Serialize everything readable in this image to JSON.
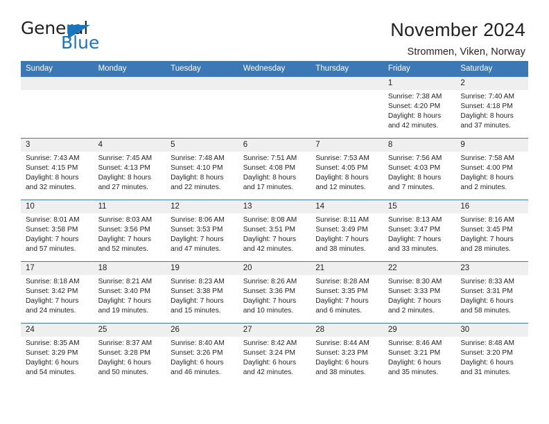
{
  "logo": {
    "word_top": "General",
    "word_bottom": "Blue",
    "triangle": "triangle-icon",
    "accent_color": "#1b75bc"
  },
  "header": {
    "title": "November 2024",
    "subtitle": "Strommen, Viken, Norway"
  },
  "theme": {
    "header_bar": "#3b78b5",
    "daynum_band": "#efefef",
    "text": "#231f20"
  },
  "weekdays": [
    "Sunday",
    "Monday",
    "Tuesday",
    "Wednesday",
    "Thursday",
    "Friday",
    "Saturday"
  ],
  "labels": {
    "sunrise": "Sunrise:",
    "sunset": "Sunset:",
    "daylight": "Daylight:"
  },
  "weeks": [
    [
      {
        "day": "",
        "blank": true
      },
      {
        "day": "",
        "blank": true
      },
      {
        "day": "",
        "blank": true
      },
      {
        "day": "",
        "blank": true
      },
      {
        "day": "",
        "blank": true
      },
      {
        "day": "1",
        "sunrise": "Sunrise: 7:38 AM",
        "sunset": "Sunset: 4:20 PM",
        "daylight1": "Daylight: 8 hours",
        "daylight2": "and 42 minutes."
      },
      {
        "day": "2",
        "sunrise": "Sunrise: 7:40 AM",
        "sunset": "Sunset: 4:18 PM",
        "daylight1": "Daylight: 8 hours",
        "daylight2": "and 37 minutes."
      }
    ],
    [
      {
        "day": "3",
        "sunrise": "Sunrise: 7:43 AM",
        "sunset": "Sunset: 4:15 PM",
        "daylight1": "Daylight: 8 hours",
        "daylight2": "and 32 minutes."
      },
      {
        "day": "4",
        "sunrise": "Sunrise: 7:45 AM",
        "sunset": "Sunset: 4:13 PM",
        "daylight1": "Daylight: 8 hours",
        "daylight2": "and 27 minutes."
      },
      {
        "day": "5",
        "sunrise": "Sunrise: 7:48 AM",
        "sunset": "Sunset: 4:10 PM",
        "daylight1": "Daylight: 8 hours",
        "daylight2": "and 22 minutes."
      },
      {
        "day": "6",
        "sunrise": "Sunrise: 7:51 AM",
        "sunset": "Sunset: 4:08 PM",
        "daylight1": "Daylight: 8 hours",
        "daylight2": "and 17 minutes."
      },
      {
        "day": "7",
        "sunrise": "Sunrise: 7:53 AM",
        "sunset": "Sunset: 4:05 PM",
        "daylight1": "Daylight: 8 hours",
        "daylight2": "and 12 minutes."
      },
      {
        "day": "8",
        "sunrise": "Sunrise: 7:56 AM",
        "sunset": "Sunset: 4:03 PM",
        "daylight1": "Daylight: 8 hours",
        "daylight2": "and 7 minutes."
      },
      {
        "day": "9",
        "sunrise": "Sunrise: 7:58 AM",
        "sunset": "Sunset: 4:00 PM",
        "daylight1": "Daylight: 8 hours",
        "daylight2": "and 2 minutes."
      }
    ],
    [
      {
        "day": "10",
        "sunrise": "Sunrise: 8:01 AM",
        "sunset": "Sunset: 3:58 PM",
        "daylight1": "Daylight: 7 hours",
        "daylight2": "and 57 minutes."
      },
      {
        "day": "11",
        "sunrise": "Sunrise: 8:03 AM",
        "sunset": "Sunset: 3:56 PM",
        "daylight1": "Daylight: 7 hours",
        "daylight2": "and 52 minutes."
      },
      {
        "day": "12",
        "sunrise": "Sunrise: 8:06 AM",
        "sunset": "Sunset: 3:53 PM",
        "daylight1": "Daylight: 7 hours",
        "daylight2": "and 47 minutes."
      },
      {
        "day": "13",
        "sunrise": "Sunrise: 8:08 AM",
        "sunset": "Sunset: 3:51 PM",
        "daylight1": "Daylight: 7 hours",
        "daylight2": "and 42 minutes."
      },
      {
        "day": "14",
        "sunrise": "Sunrise: 8:11 AM",
        "sunset": "Sunset: 3:49 PM",
        "daylight1": "Daylight: 7 hours",
        "daylight2": "and 38 minutes."
      },
      {
        "day": "15",
        "sunrise": "Sunrise: 8:13 AM",
        "sunset": "Sunset: 3:47 PM",
        "daylight1": "Daylight: 7 hours",
        "daylight2": "and 33 minutes."
      },
      {
        "day": "16",
        "sunrise": "Sunrise: 8:16 AM",
        "sunset": "Sunset: 3:45 PM",
        "daylight1": "Daylight: 7 hours",
        "daylight2": "and 28 minutes."
      }
    ],
    [
      {
        "day": "17",
        "sunrise": "Sunrise: 8:18 AM",
        "sunset": "Sunset: 3:42 PM",
        "daylight1": "Daylight: 7 hours",
        "daylight2": "and 24 minutes."
      },
      {
        "day": "18",
        "sunrise": "Sunrise: 8:21 AM",
        "sunset": "Sunset: 3:40 PM",
        "daylight1": "Daylight: 7 hours",
        "daylight2": "and 19 minutes."
      },
      {
        "day": "19",
        "sunrise": "Sunrise: 8:23 AM",
        "sunset": "Sunset: 3:38 PM",
        "daylight1": "Daylight: 7 hours",
        "daylight2": "and 15 minutes."
      },
      {
        "day": "20",
        "sunrise": "Sunrise: 8:26 AM",
        "sunset": "Sunset: 3:36 PM",
        "daylight1": "Daylight: 7 hours",
        "daylight2": "and 10 minutes."
      },
      {
        "day": "21",
        "sunrise": "Sunrise: 8:28 AM",
        "sunset": "Sunset: 3:35 PM",
        "daylight1": "Daylight: 7 hours",
        "daylight2": "and 6 minutes."
      },
      {
        "day": "22",
        "sunrise": "Sunrise: 8:30 AM",
        "sunset": "Sunset: 3:33 PM",
        "daylight1": "Daylight: 7 hours",
        "daylight2": "and 2 minutes."
      },
      {
        "day": "23",
        "sunrise": "Sunrise: 8:33 AM",
        "sunset": "Sunset: 3:31 PM",
        "daylight1": "Daylight: 6 hours",
        "daylight2": "and 58 minutes."
      }
    ],
    [
      {
        "day": "24",
        "sunrise": "Sunrise: 8:35 AM",
        "sunset": "Sunset: 3:29 PM",
        "daylight1": "Daylight: 6 hours",
        "daylight2": "and 54 minutes."
      },
      {
        "day": "25",
        "sunrise": "Sunrise: 8:37 AM",
        "sunset": "Sunset: 3:28 PM",
        "daylight1": "Daylight: 6 hours",
        "daylight2": "and 50 minutes."
      },
      {
        "day": "26",
        "sunrise": "Sunrise: 8:40 AM",
        "sunset": "Sunset: 3:26 PM",
        "daylight1": "Daylight: 6 hours",
        "daylight2": "and 46 minutes."
      },
      {
        "day": "27",
        "sunrise": "Sunrise: 8:42 AM",
        "sunset": "Sunset: 3:24 PM",
        "daylight1": "Daylight: 6 hours",
        "daylight2": "and 42 minutes."
      },
      {
        "day": "28",
        "sunrise": "Sunrise: 8:44 AM",
        "sunset": "Sunset: 3:23 PM",
        "daylight1": "Daylight: 6 hours",
        "daylight2": "and 38 minutes."
      },
      {
        "day": "29",
        "sunrise": "Sunrise: 8:46 AM",
        "sunset": "Sunset: 3:21 PM",
        "daylight1": "Daylight: 6 hours",
        "daylight2": "and 35 minutes."
      },
      {
        "day": "30",
        "sunrise": "Sunrise: 8:48 AM",
        "sunset": "Sunset: 3:20 PM",
        "daylight1": "Daylight: 6 hours",
        "daylight2": "and 31 minutes."
      }
    ]
  ]
}
